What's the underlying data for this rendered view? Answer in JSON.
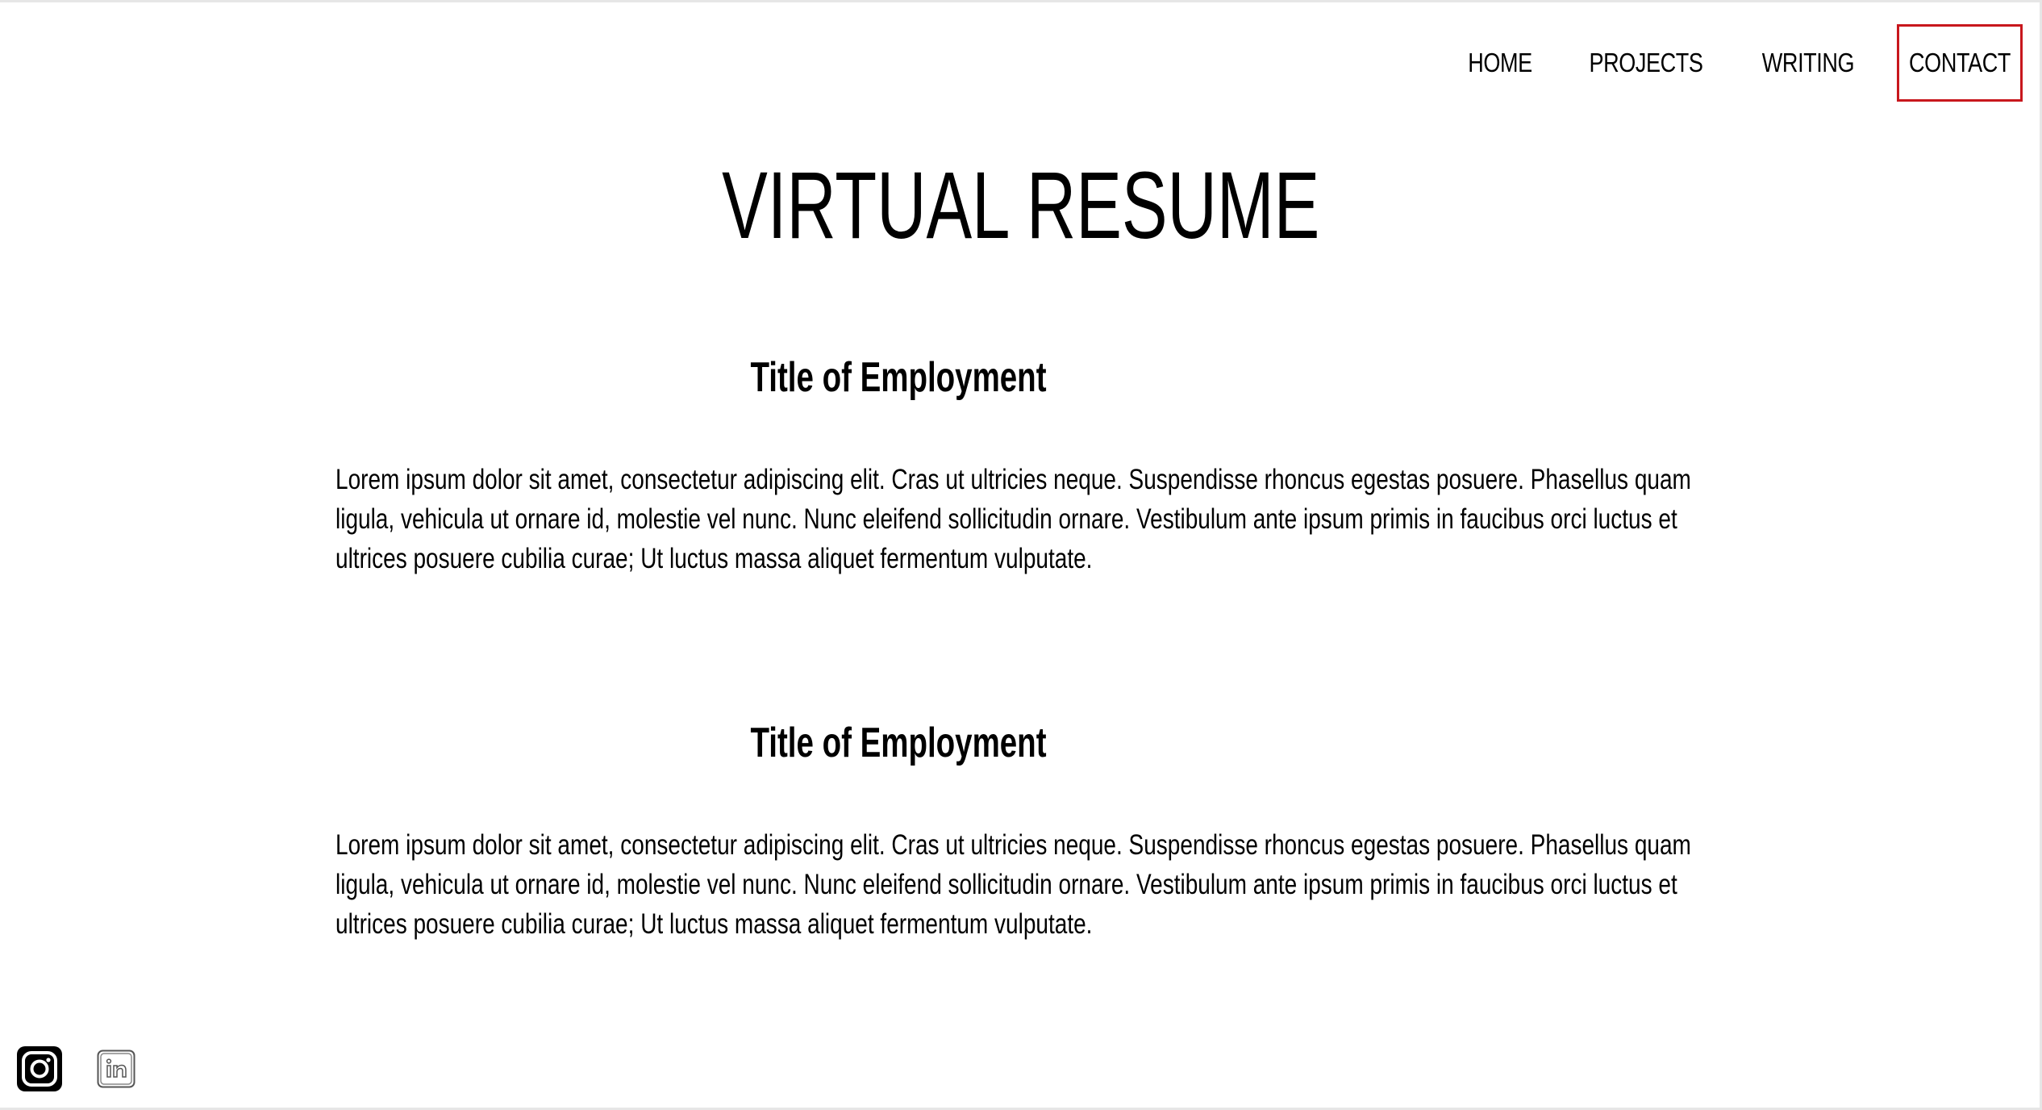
{
  "nav": {
    "items": [
      {
        "label": "HOME"
      },
      {
        "label": "PROJECTS"
      },
      {
        "label": "WRITING"
      },
      {
        "label": "CONTACT"
      }
    ],
    "active_border_color": "#c8171d"
  },
  "page": {
    "title": "VIRTUAL RESUME"
  },
  "jobs": [
    {
      "title": "Title of Employment",
      "description": "Lorem ipsum dolor sit amet, consectetur adipiscing elit. Cras ut ultricies neque. Suspendisse rhoncus egestas posuere. Phasellus quam ligula, vehicula ut ornare id, molestie vel nunc. Nunc eleifend sollicitudin ornare. Vestibulum ante ipsum primis in faucibus orci luctus et ultrices posuere cubilia curae; Ut luctus massa aliquet fermentum vulputate."
    },
    {
      "title": "Title of Employment",
      "description": "Lorem ipsum dolor sit amet, consectetur adipiscing elit. Cras ut ultricies neque. Suspendisse rhoncus egestas posuere. Phasellus quam ligula, vehicula ut ornare id, molestie vel nunc. Nunc eleifend sollicitudin ornare. Vestibulum ante ipsum primis in faucibus orci luctus et ultrices posuere cubilia curae; Ut luctus massa aliquet fermentum vulputate."
    }
  ],
  "social": {
    "icons": [
      "instagram-icon",
      "linkedin-icon"
    ]
  }
}
